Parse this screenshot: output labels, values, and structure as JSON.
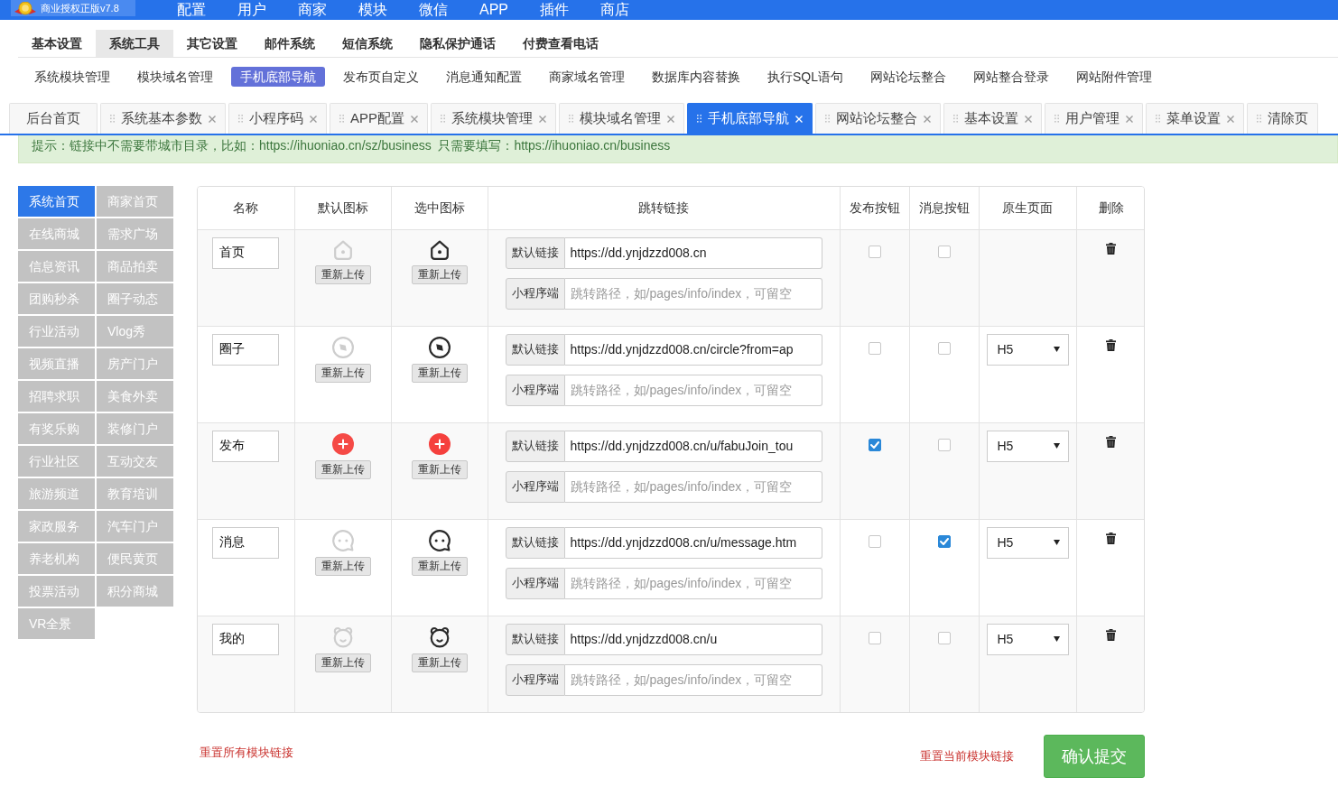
{
  "top_bar": {
    "logo_text": "商业授权正版v7.8",
    "menu": [
      "配置",
      "用户",
      "商家",
      "模块",
      "微信",
      "APP",
      "插件",
      "商店"
    ]
  },
  "primary_tabs": [
    {
      "label": "基本设置",
      "selected": false
    },
    {
      "label": "系统工具",
      "selected": true
    },
    {
      "label": "其它设置",
      "selected": false
    },
    {
      "label": "邮件系统",
      "selected": false
    },
    {
      "label": "短信系统",
      "selected": false
    },
    {
      "label": "隐私保护通话",
      "selected": false
    },
    {
      "label": "付费查看电话",
      "selected": false
    }
  ],
  "sub_tabs": [
    {
      "label": "系统模块管理",
      "selected": false
    },
    {
      "label": "模块域名管理",
      "selected": false
    },
    {
      "label": "手机底部导航",
      "selected": true
    },
    {
      "label": "发布页自定义",
      "selected": false
    },
    {
      "label": "消息通知配置",
      "selected": false
    },
    {
      "label": "商家域名管理",
      "selected": false
    },
    {
      "label": "数据库内容替换",
      "selected": false
    },
    {
      "label": "执行SQL语句",
      "selected": false
    },
    {
      "label": "网站论坛整合",
      "selected": false
    },
    {
      "label": "网站整合登录",
      "selected": false
    },
    {
      "label": "网站附件管理",
      "selected": false
    }
  ],
  "page_tabs": [
    {
      "label": "后台首页",
      "kind": "home",
      "selected": false,
      "closable": false
    },
    {
      "label": "系统基本参数",
      "kind": "page",
      "selected": false,
      "closable": true
    },
    {
      "label": "小程序码",
      "kind": "page",
      "selected": false,
      "closable": true
    },
    {
      "label": "APP配置",
      "kind": "page",
      "selected": false,
      "closable": true
    },
    {
      "label": "系统模块管理",
      "kind": "page",
      "selected": false,
      "closable": true
    },
    {
      "label": "模块域名管理",
      "kind": "page",
      "selected": false,
      "closable": true
    },
    {
      "label": "手机底部导航",
      "kind": "page",
      "selected": true,
      "closable": true
    },
    {
      "label": "网站论坛整合",
      "kind": "page",
      "selected": false,
      "closable": true
    },
    {
      "label": "基本设置",
      "kind": "page",
      "selected": false,
      "closable": true
    },
    {
      "label": "用户管理",
      "kind": "page",
      "selected": false,
      "closable": true
    },
    {
      "label": "菜单设置",
      "kind": "page",
      "selected": false,
      "closable": true
    },
    {
      "label": "清除页",
      "kind": "page",
      "selected": false,
      "closable": false
    }
  ],
  "hint": "提示：链接中不需要带城市目录，比如：https://ihuoniao.cn/sz/business  只需要填写：https://ihuoniao.cn/business",
  "modules": [
    {
      "label": "系统首页",
      "selected": true
    },
    {
      "label": "商家首页",
      "selected": false
    },
    {
      "label": "在线商城",
      "selected": false
    },
    {
      "label": "需求广场",
      "selected": false
    },
    {
      "label": "信息资讯",
      "selected": false
    },
    {
      "label": "商品拍卖",
      "selected": false
    },
    {
      "label": "团购秒杀",
      "selected": false
    },
    {
      "label": "圈子动态",
      "selected": false
    },
    {
      "label": "行业活动",
      "selected": false
    },
    {
      "label": "Vlog秀",
      "selected": false
    },
    {
      "label": "视频直播",
      "selected": false
    },
    {
      "label": "房产门户",
      "selected": false
    },
    {
      "label": "招聘求职",
      "selected": false
    },
    {
      "label": "美食外卖",
      "selected": false
    },
    {
      "label": "有奖乐购",
      "selected": false
    },
    {
      "label": "装修门户",
      "selected": false
    },
    {
      "label": "行业社区",
      "selected": false
    },
    {
      "label": "互动交友",
      "selected": false
    },
    {
      "label": "旅游频道",
      "selected": false
    },
    {
      "label": "教育培训",
      "selected": false
    },
    {
      "label": "家政服务",
      "selected": false
    },
    {
      "label": "汽车门户",
      "selected": false
    },
    {
      "label": "养老机构",
      "selected": false
    },
    {
      "label": "便民黄页",
      "selected": false
    },
    {
      "label": "投票活动",
      "selected": false
    },
    {
      "label": "积分商城",
      "selected": false
    },
    {
      "label": "VR全景",
      "selected": false
    }
  ],
  "table": {
    "columns": [
      "名称",
      "默认图标",
      "选中图标",
      "跳转链接",
      "发布按钮",
      "消息按钮",
      "原生页面",
      "删除"
    ],
    "rows": [
      {
        "kind": "home",
        "name": "首页",
        "default_upload": "重新上传",
        "selected_upload": "重新上传",
        "links": [
          {
            "label": "默认链接",
            "value": "https://dd.ynjdzzd008.cn"
          },
          {
            "label": "小程序端",
            "placeholder": "跳转路径，如/pages/info/index，可留空"
          }
        ],
        "publish_checked": false,
        "message_checked": false
      },
      {
        "kind": "compass",
        "name": "圈子",
        "default_upload": "重新上传",
        "selected_upload": "重新上传",
        "links": [
          {
            "label": "默认链接",
            "value": "https://dd.ynjdzzd008.cn/circle?from=ap"
          },
          {
            "label": "小程序端",
            "placeholder": "跳转路径，如/pages/info/index，可留空"
          }
        ],
        "publish_checked": false,
        "message_checked": false,
        "native_page": "H5"
      },
      {
        "kind": "publish",
        "name": "发布",
        "default_upload": "重新上传",
        "selected_upload": "重新上传",
        "links": [
          {
            "label": "默认链接",
            "value": "https://dd.ynjdzzd008.cn/u/fabuJoin_tou"
          },
          {
            "label": "小程序端",
            "placeholder": "跳转路径，如/pages/info/index，可留空"
          }
        ],
        "publish_checked": true,
        "message_checked": false,
        "native_page": "H5"
      },
      {
        "kind": "message",
        "name": "消息",
        "default_upload": "重新上传",
        "selected_upload": "重新上传",
        "links": [
          {
            "label": "默认链接",
            "value": "https://dd.ynjdzzd008.cn/u/message.htm"
          },
          {
            "label": "小程序端",
            "placeholder": "跳转路径，如/pages/info/index，可留空"
          }
        ],
        "publish_checked": false,
        "message_checked": true,
        "native_page": "H5"
      },
      {
        "kind": "profile",
        "name": "我的",
        "default_upload": "重新上传",
        "selected_upload": "重新上传",
        "links": [
          {
            "label": "默认链接",
            "value": "https://dd.ynjdzzd008.cn/u"
          },
          {
            "label": "小程序端",
            "placeholder": "跳转路径，如/pages/info/index，可留空"
          }
        ],
        "publish_checked": false,
        "message_checked": false,
        "native_page": "H5"
      }
    ]
  },
  "footer": {
    "reset_all": "重置所有模块链接",
    "reset_current": "重置当前模块链接",
    "submit": "确认提交"
  }
}
